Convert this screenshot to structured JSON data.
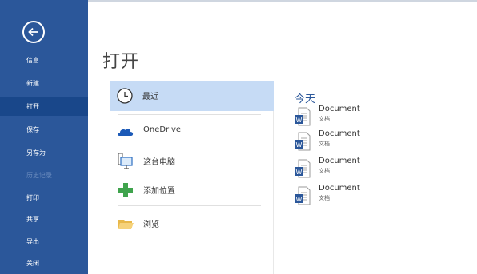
{
  "sidebar": {
    "back_label": "back",
    "items": [
      {
        "label": "信息"
      },
      {
        "label": "新建"
      },
      {
        "label": "打开"
      },
      {
        "label": "保存"
      },
      {
        "label": "另存为"
      },
      {
        "label": "历史记录"
      },
      {
        "label": "打印"
      },
      {
        "label": "共享"
      },
      {
        "label": "导出"
      },
      {
        "label": "关闭"
      }
    ],
    "active_index": 2
  },
  "main": {
    "title": "打开",
    "locations": [
      {
        "label": "最近",
        "icon": "clock-icon"
      },
      {
        "label": "OneDrive",
        "icon": "cloud-icon"
      },
      {
        "label": "这台电脑",
        "icon": "computer-icon"
      },
      {
        "label": "添加位置",
        "icon": "plus-icon"
      },
      {
        "label": "浏览",
        "icon": "folder-icon"
      }
    ],
    "recent": {
      "heading": "今天",
      "documents": [
        {
          "name": "Document",
          "location": "文档"
        },
        {
          "name": "Document",
          "location": "文档"
        },
        {
          "name": "Document",
          "location": "文档"
        },
        {
          "name": "Document",
          "location": "文档"
        }
      ]
    }
  },
  "colors": {
    "sidebar_bg": "#2b579a",
    "sidebar_active": "#19478a",
    "selected_bg": "#c6dbf5",
    "accent": "#2b579a"
  }
}
